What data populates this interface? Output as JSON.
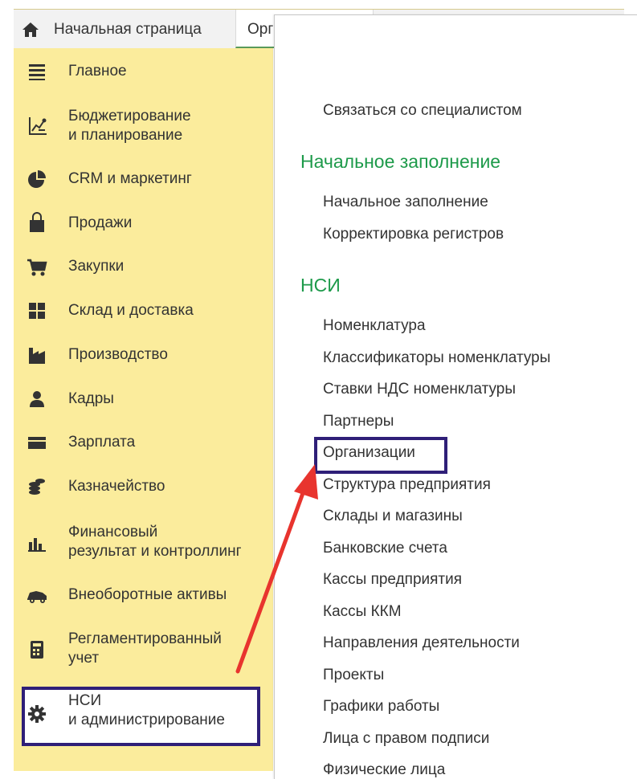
{
  "tabs": {
    "home_label": "Начальная страница",
    "active_label": "Орг"
  },
  "sidebar": {
    "items": [
      {
        "label": "Главное",
        "icon": "list-icon"
      },
      {
        "label": "Бюджетирование\nи планирование",
        "icon": "budget-chart-icon"
      },
      {
        "label": "CRM и маркетинг",
        "icon": "pie-chart-icon"
      },
      {
        "label": "Продажи",
        "icon": "shopping-bag-icon"
      },
      {
        "label": "Закупки",
        "icon": "cart-icon"
      },
      {
        "label": "Склад и доставка",
        "icon": "warehouse-grid-icon"
      },
      {
        "label": "Производство",
        "icon": "factory-icon"
      },
      {
        "label": "Кадры",
        "icon": "person-icon"
      },
      {
        "label": "Зарплата",
        "icon": "wallet-icon"
      },
      {
        "label": "Казначейство",
        "icon": "coins-icon"
      },
      {
        "label": "Финансовый\nрезультат и контроллинг",
        "icon": "bar-chart-icon"
      },
      {
        "label": "Внеоборотные активы",
        "icon": "car-icon"
      },
      {
        "label": "Регламентированный\nучет",
        "icon": "calculator-icon"
      },
      {
        "label": "НСИ\nи администрирование",
        "icon": "gear-icon"
      }
    ]
  },
  "panel": {
    "contact_link": "Связаться со специалистом",
    "group_initial": "Начальное заполнение",
    "initial_links": [
      "Начальное заполнение",
      "Корректировка регистров"
    ],
    "group_nsi": "НСИ",
    "nsi_links": [
      "Номенклатура",
      "Классификаторы номенклатуры",
      "Ставки НДС номенклатуры",
      "Партнеры",
      "Организации",
      "Структура предприятия",
      "Склады и магазины",
      "Банковские счета",
      "Кассы предприятия",
      "Кассы ККМ",
      "Направления деятельности",
      "Проекты",
      "Графики работы",
      "Лица с правом подписи",
      "Физические лица"
    ]
  },
  "colors": {
    "sidebar_bg": "#fbec9c",
    "group_heading": "#1d9a4a",
    "highlight_border": "#2f1f78",
    "arrow": "#e8342e"
  }
}
